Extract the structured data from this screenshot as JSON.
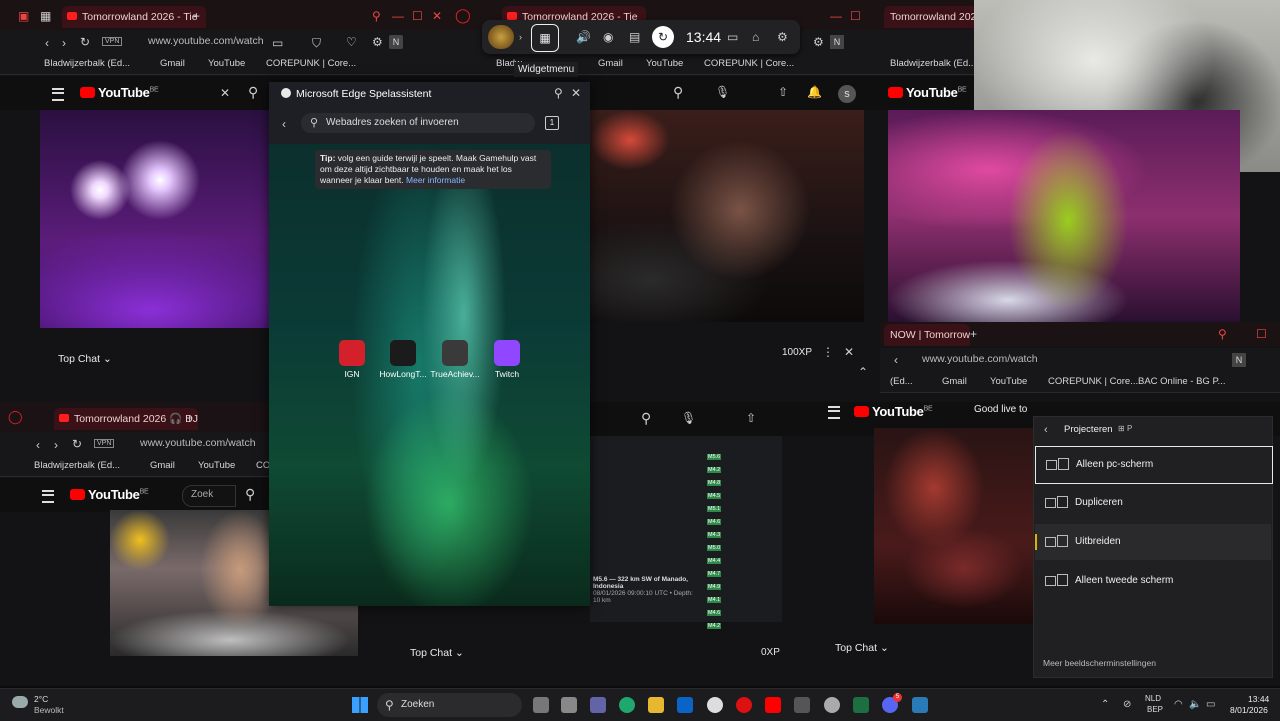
{
  "windows": {
    "top_left": {
      "tab_title": "Tomorrowland 2026 - Tie",
      "url": "www.youtube.com/watch",
      "vpn": "VPN",
      "bookmarks": [
        "Bladwijzerbalk (Ed...",
        "Gmail",
        "YouTube",
        "COREPUNK | Core..."
      ],
      "yt_logo": "YouTube",
      "yt_region": "BE",
      "top_chat": "Top Chat"
    },
    "top_mid": {
      "tab_title": "Tomorrowland 2026 - Tie",
      "bookmarks": [
        "Bladw",
        "Gmail",
        "YouTube",
        "COREPUNK | Core..."
      ],
      "xp": "100XP"
    },
    "top_right": {
      "tab_title": "Tomorrowland 2026",
      "bookmarks": [
        "Bladwijzerbalk (Ed..."
      ],
      "yt_logo": "YouTube",
      "yt_region": "BE"
    },
    "mid_right": {
      "tab_title": "NOW | Tomorrowl",
      "url": "www.youtube.com/watch",
      "bookmarks": [
        "(Ed...",
        "Gmail",
        "YouTube",
        "COREPUNK | Core...",
        "BAC Online - BG P..."
      ]
    },
    "bottom_left": {
      "tab_title": "Tomorrowland 2026 🎧 DJ",
      "url": "www.youtube.com/watch",
      "vpn": "VPN",
      "bookmarks": [
        "Bladwijzerbalk (Ed...",
        "Gmail",
        "YouTube",
        "CO"
      ],
      "yt_logo": "YouTube",
      "yt_region": "BE",
      "search_placeholder": "Zoek"
    },
    "bottom_mid": {
      "top_chat": "Top Chat",
      "xp": "0XP",
      "quake": {
        "title": "M5.6 — 322 km SW of Manado, Indonesia",
        "sub": "08/01/2026 09:00:10 UTC • Depth: 10 km",
        "items": [
          "M5.6",
          "M4.2",
          "M4.8",
          "M4.5",
          "M5.1",
          "M4.6",
          "M4.3",
          "M5.0",
          "M4.4",
          "M4.7",
          "M4.9",
          "M4.1",
          "M4.6",
          "M4.2"
        ]
      }
    },
    "bottom_right": {
      "yt_logo": "YouTube",
      "yt_region": "BE",
      "search_value": "Good live to",
      "top_chat": "Top Chat"
    }
  },
  "game_bar": {
    "time": "13:44",
    "tooltip": "Widgetmenu"
  },
  "assistant": {
    "title": "Microsoft Edge Spelassistent",
    "search_placeholder": "Webadres zoeken of invoeren",
    "tab_count": "1",
    "tip_bold": "Tip:",
    "tip_text": " volg een guide terwijl je speelt. Maak Gamehulp vast om deze altijd zichtbaar te houden en maak het los wanneer je klaar bent.",
    "tip_link": "Meer informatie",
    "apps": [
      {
        "label": "IGN",
        "color": "#d3202a"
      },
      {
        "label": "HowLongT...",
        "color": "#1b1b1b"
      },
      {
        "label": "TrueAchiev...",
        "color": "#3a3a3a"
      },
      {
        "label": "Twitch",
        "color": "#9146ff"
      }
    ]
  },
  "project": {
    "title": "Projecteren",
    "shortcut": "P",
    "options": [
      "Alleen pc-scherm",
      "Dupliceren",
      "Uitbreiden",
      "Alleen tweede scherm"
    ],
    "selected_index": 0,
    "active_index": 2,
    "footer": "Meer beeldscherminstellingen"
  },
  "taskbar": {
    "weather_temp": "2°C",
    "weather_desc": "Bewolkt",
    "search": "Zoeken",
    "lang_top": "NLD",
    "lang_bottom": "BEP",
    "time": "13:44",
    "date": "8/01/2026",
    "discord_badge": "5"
  },
  "colors": {
    "accent_red": "#ff0000",
    "edge_tab": "#3a1116",
    "twitch": "#9146ff"
  }
}
